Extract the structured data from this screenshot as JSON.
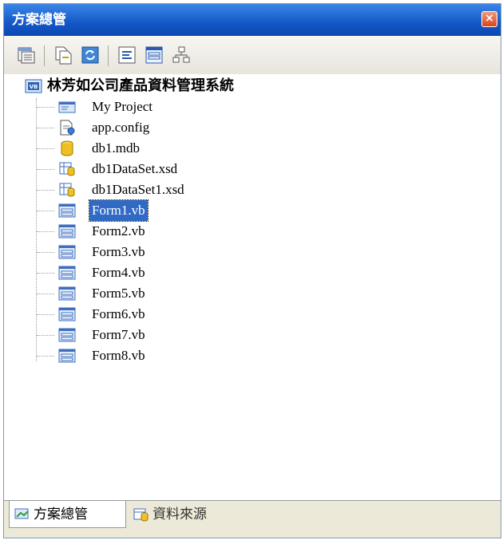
{
  "window": {
    "title": "方案總管",
    "close_label": "×"
  },
  "toolbar": {
    "buttons": [
      {
        "name": "properties",
        "icon": "properties-icon"
      },
      {
        "name": "show-all-files",
        "icon": "show-all-files-icon"
      },
      {
        "name": "refresh",
        "icon": "refresh-icon"
      },
      {
        "name": "view-code",
        "icon": "view-code-icon"
      },
      {
        "name": "view-designer",
        "icon": "view-designer-icon"
      },
      {
        "name": "class-diagram",
        "icon": "class-diagram-icon"
      }
    ]
  },
  "tree": {
    "root": {
      "label": "林芳如公司產品資料管理系統",
      "icon": "vb-project-icon"
    },
    "items": [
      {
        "label": "My Project",
        "icon": "my-project-icon"
      },
      {
        "label": "app.config",
        "icon": "config-file-icon"
      },
      {
        "label": "db1.mdb",
        "icon": "database-icon"
      },
      {
        "label": "db1DataSet.xsd",
        "icon": "dataset-icon"
      },
      {
        "label": "db1DataSet1.xsd",
        "icon": "dataset-icon"
      },
      {
        "label": "Form1.vb",
        "icon": "form-icon",
        "selected": true
      },
      {
        "label": "Form2.vb",
        "icon": "form-icon"
      },
      {
        "label": "Form3.vb",
        "icon": "form-icon"
      },
      {
        "label": "Form4.vb",
        "icon": "form-icon"
      },
      {
        "label": "Form5.vb",
        "icon": "form-icon"
      },
      {
        "label": "Form6.vb",
        "icon": "form-icon"
      },
      {
        "label": "Form7.vb",
        "icon": "form-icon"
      },
      {
        "label": "Form8.vb",
        "icon": "form-icon"
      }
    ]
  },
  "tabs": [
    {
      "label": "方案總管",
      "icon": "solution-explorer-icon",
      "active": true
    },
    {
      "label": "資料來源",
      "icon": "data-sources-icon",
      "active": false
    }
  ],
  "colors": {
    "title_bar": "#1457c7",
    "selection": "#316ac5",
    "chrome": "#ece9d8"
  }
}
